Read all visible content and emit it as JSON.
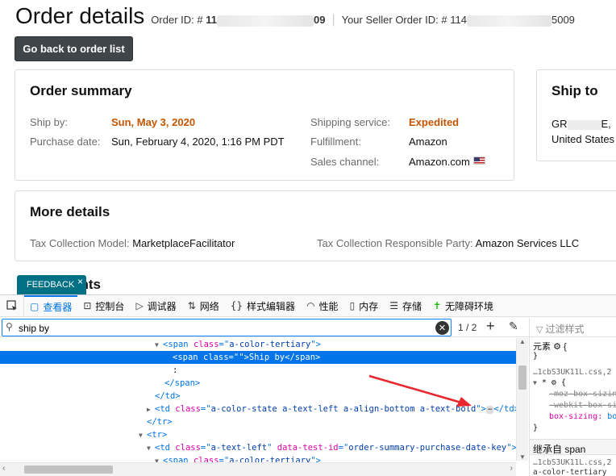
{
  "page": {
    "title": "Order details",
    "order_id_label": "Order ID: #",
    "order_id_prefix": "11",
    "order_id_suffix": "09",
    "seller_order_id_label": "Your Seller Order ID: #",
    "seller_order_id_prefix": "114",
    "seller_order_id_suffix": "5009",
    "back_button": "Go back to order list"
  },
  "order_summary": {
    "title": "Order summary",
    "ship_by_label": "Ship by:",
    "ship_by_value": "Sun, May 3, 2020",
    "purchase_date_label": "Purchase date:",
    "purchase_date_value": "Sun, February 4, 2020, 1:16 PM PDT",
    "shipping_service_label": "Shipping service:",
    "shipping_service_value": "Expedited",
    "fulfillment_label": "Fulfillment:",
    "fulfillment_value": "Amazon",
    "sales_channel_label": "Sales channel:",
    "sales_channel_value": "Amazon.com"
  },
  "ship_to": {
    "title": "Ship to",
    "address_line1": "GR",
    "address_line1_end": "E,",
    "address_line2": "United States"
  },
  "more_details": {
    "title": "More details",
    "tax_model_label": "Tax Collection Model:",
    "tax_model_value": "MarketplaceFacilitator",
    "tax_party_label": "Tax Collection Responsible Party:",
    "tax_party_value": "Amazon Services LLC"
  },
  "feedback": {
    "label": "FEEDBACK",
    "close": "×"
  },
  "partial_heading": "ents",
  "devtools": {
    "tabs": [
      {
        "icon": "inspector-icon",
        "label": "查看器"
      },
      {
        "icon": "console-icon",
        "label": "控制台"
      },
      {
        "icon": "debugger-icon",
        "label": "调试器"
      },
      {
        "icon": "network-icon",
        "label": "网络"
      },
      {
        "icon": "style-editor-icon",
        "label": "样式编辑器"
      },
      {
        "icon": "performance-icon",
        "label": "性能"
      },
      {
        "icon": "memory-icon",
        "label": "内存"
      },
      {
        "icon": "storage-icon",
        "label": "存储"
      },
      {
        "icon": "accessibility-icon",
        "label": "无障碍环境"
      }
    ],
    "search_value": "ship by",
    "match_count": "1 / 2",
    "rules_filter_placeholder": "过滤样式",
    "inherited_label": "继承自 span",
    "rules": {
      "element_label": "元素",
      "brace_open": "{",
      "brace_close": "}",
      "source1": "…1cbS3UK11L.css,2",
      "prop1": "-moz-box-sizin",
      "prop2": "-webkit-box-si",
      "prop3": "box-sizing:",
      "prop3_val": "bo",
      "source2": "…1cbS3UK11L.css,2",
      "partial": "a-color-tertiary"
    },
    "tree": {
      "l1_class": "a-color-tertiary",
      "l2_class": "",
      "l2_text": "Ship by",
      "l3_text": ":",
      "l6_class": "a-color-state a-text-left a-align-bottom a-text-bold",
      "l9_class": "a-text-left",
      "l9_attr_val": "order-summary-purchase-date-key",
      "l10_class": "a-color-tertiary"
    }
  }
}
